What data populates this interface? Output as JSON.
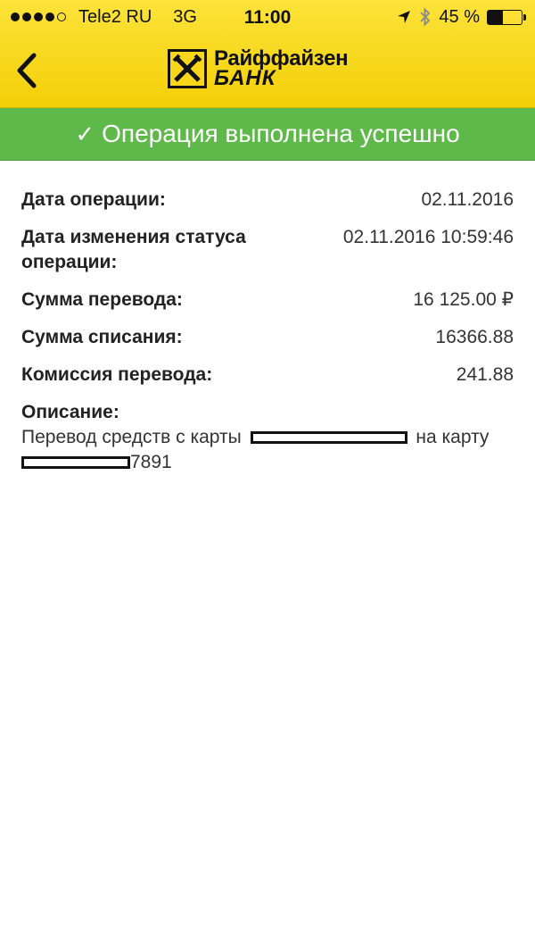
{
  "status_bar": {
    "carrier": "Tele2 RU",
    "network": "3G",
    "time": "11:00",
    "battery": "45 %",
    "battery_level": 0.45
  },
  "header": {
    "logo_line1": "Райффайзен",
    "logo_line2": "БАНК",
    "back_icon": "chevron-left-icon"
  },
  "banner": {
    "check": "✓",
    "text": "Операция выполнена успешно",
    "color": "#5fb94a"
  },
  "details": {
    "operation_date_label": "Дата операции:",
    "operation_date_value": "02.11.2016",
    "status_change_label": "Дата изменения статуса операции:",
    "status_change_value": "02.11.2016 10:59:46",
    "amount_label": "Сумма перевода:",
    "amount_value": "16 125.00 ₽",
    "debit_label": "Сумма списания:",
    "debit_value": "16366.88",
    "fee_label": "Комиссия перевода:",
    "fee_value": "241.88"
  },
  "description": {
    "label": "Описание:",
    "text_part1": "Перевод средств с карты",
    "text_part2": "на карту",
    "card_suffix": "7891"
  },
  "colors": {
    "header_yellow": "#fde33a",
    "success_green": "#5fb94a"
  }
}
